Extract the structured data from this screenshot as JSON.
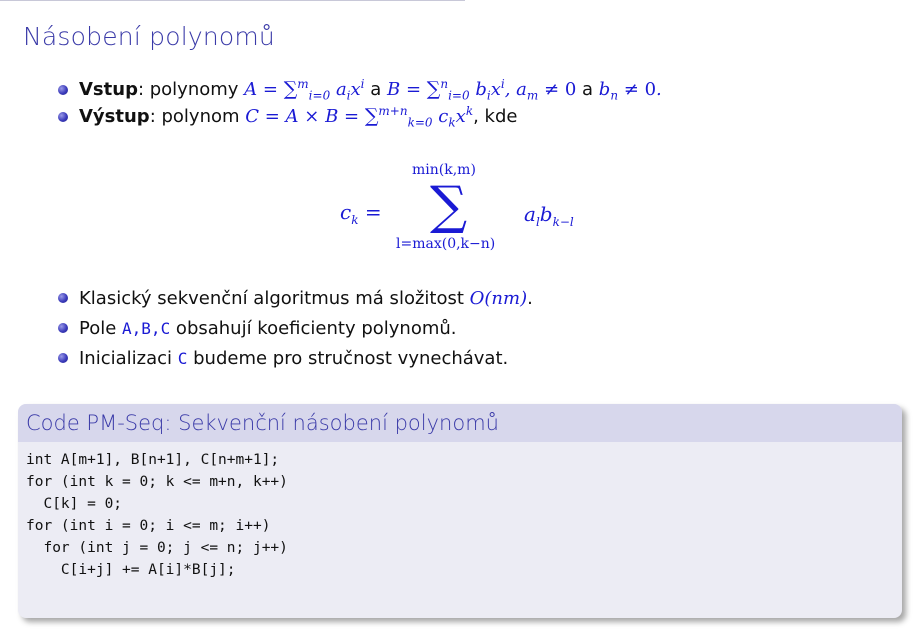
{
  "slide": {
    "title": "Násobení polynomů",
    "input": {
      "label": "Vstup",
      "text1": ": polynomy ",
      "A": "A",
      "sum_from": "i=0",
      "sum_to_a": "m",
      "a_term": "a",
      "a_sub": "i",
      "x": "x",
      "x_sup": "i",
      "and": " a ",
      "B": "B",
      "sum_to_b": "n",
      "b_term": "b",
      "cond_a": "a",
      "cond_a_sub": "m",
      "neq": "≠ 0",
      "cond_b": "b",
      "cond_b_sub": "n"
    },
    "output": {
      "label": "Výstup",
      "text1": ": polynom ",
      "expr": "C = A × B = ",
      "sum_from": "k=0",
      "sum_to": "m+n",
      "term": "c",
      "term_sub": "k",
      "x_sup": "k",
      "text2": ", kde"
    },
    "formula": {
      "lhs": "c",
      "lhs_sub": "k",
      "upper": "min(k,m)",
      "sigma": "∑",
      "lower": "l=max(0,k−n)",
      "term": "a",
      "term_sub": "l",
      "term2": "b",
      "term2_sub": "k−l"
    },
    "notes": [
      {
        "text": "Klasický sekvenční algoritmus má složitost ",
        "math": "O(nm)",
        "suffix": "."
      },
      {
        "text": "Pole ",
        "code": "A,B,C",
        "suffix": " obsahují koeficienty polynomů."
      },
      {
        "text": "Inicializaci ",
        "code": "C",
        "suffix": " budeme pro stručnost vynechávat."
      }
    ],
    "code_block": {
      "title": "Code PM-Seq: Sekvenční násobení polynomů",
      "code": "int A[m+1], B[n+1], C[n+m+1];\nfor (int k = 0; k <= m+n, k++)\n  C[k] = 0;\nfor (int i = 0; i <= m; i++)\n  for (int j = 0; j <= n; j++)\n    C[i+j] += A[i]*B[j];"
    }
  }
}
